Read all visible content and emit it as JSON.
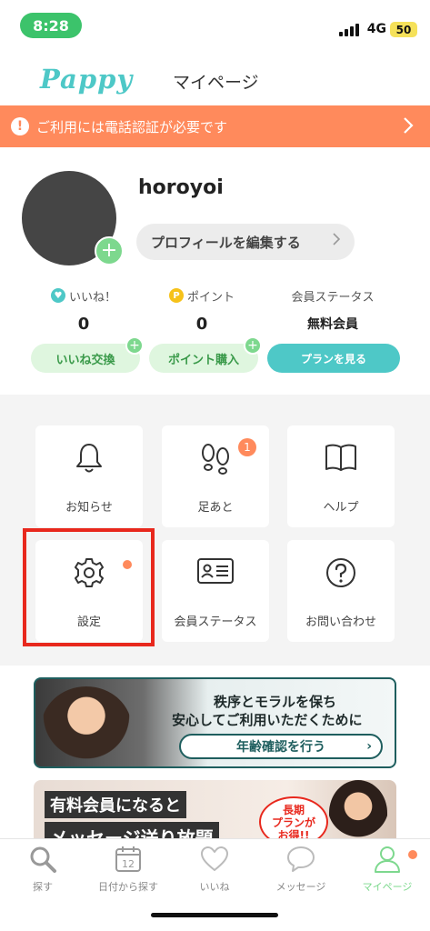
{
  "status": {
    "time": "8:28",
    "network": "4G",
    "battery": "50"
  },
  "header": {
    "logo": "Pappy",
    "title": "マイページ"
  },
  "alert": {
    "text": "ご利用には電話認証が必要です"
  },
  "profile": {
    "username": "horoyoi",
    "edit_label": "プロフィールを編集する"
  },
  "stats": {
    "likes": {
      "label": "いいね！",
      "value": "0",
      "button": "いいね交換"
    },
    "points": {
      "label": "ポイント",
      "value": "0",
      "button": "ポイント購入",
      "badge": "P"
    },
    "membership": {
      "label": "会員ステータス",
      "value": "無料会員",
      "button": "プランを見る"
    }
  },
  "tiles": [
    {
      "label": "お知らせ",
      "icon": "bell-icon"
    },
    {
      "label": "足あと",
      "icon": "footprints-icon",
      "badge": "1"
    },
    {
      "label": "ヘルプ",
      "icon": "book-icon"
    },
    {
      "label": "設定",
      "icon": "gear-icon",
      "dot": true
    },
    {
      "label": "会員ステータス",
      "icon": "id-card-icon"
    },
    {
      "label": "お問い合わせ",
      "icon": "question-icon"
    }
  ],
  "banner_age": {
    "line1": "秩序とモラルを保ち",
    "line2": "安心してご利用いただくために",
    "cta": "年齢確認を行う"
  },
  "banner_premium": {
    "line1": "有料会員になると",
    "line2": "メッセージ送り放題",
    "sticker1": "長期",
    "sticker2": "プランが",
    "sticker3": "お得!!"
  },
  "tabbar": {
    "items": [
      {
        "label": "探す",
        "icon": "search-icon"
      },
      {
        "label": "日付から探す",
        "icon": "calendar-icon",
        "calendar_day": "12"
      },
      {
        "label": "いいね",
        "icon": "heart-icon"
      },
      {
        "label": "メッセージ",
        "icon": "chat-bubble-icon"
      },
      {
        "label": "マイページ",
        "icon": "person-icon",
        "active": true
      }
    ]
  },
  "colors": {
    "accent": "#4ec8c7",
    "alert": "#ff8a5c",
    "green": "#7dd88e",
    "highlight": "#e8281d"
  }
}
